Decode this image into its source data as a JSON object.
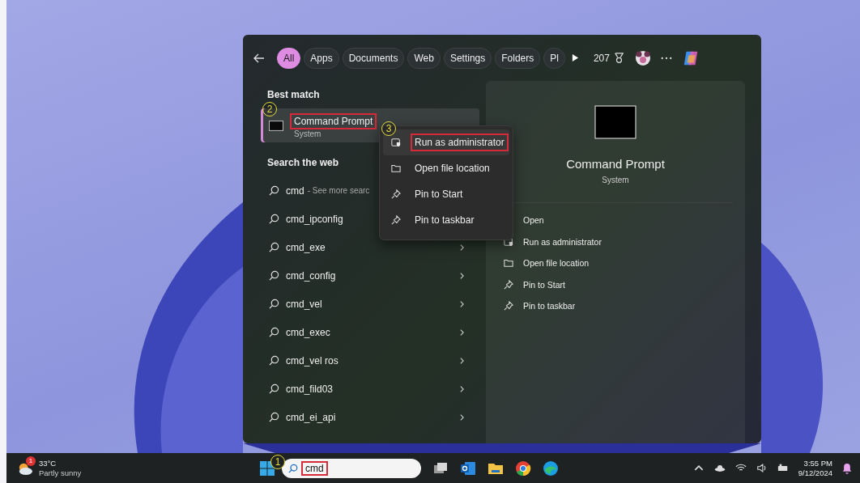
{
  "search_panel": {
    "filters": [
      {
        "label": "All",
        "selected": true
      },
      {
        "label": "Apps",
        "selected": false
      },
      {
        "label": "Documents",
        "selected": false
      },
      {
        "label": "Web",
        "selected": false
      },
      {
        "label": "Settings",
        "selected": false
      },
      {
        "label": "Folders",
        "selected": false
      },
      {
        "label": "Pl",
        "selected": false
      }
    ],
    "points": "207",
    "best_match": {
      "heading": "Best match",
      "title": "Command Prompt",
      "subtitle": "System",
      "selected": true,
      "highlighted": true,
      "callout": "2"
    },
    "web": {
      "heading": "Search the web",
      "results": [
        {
          "query": "cmd",
          "hint": "- See more searc"
        },
        {
          "query": "cmd_ipconfig"
        },
        {
          "query": "cmd_exe",
          "chevron": true
        },
        {
          "query": "cmd_config",
          "chevron": true
        },
        {
          "query": "cmd_vel",
          "chevron": true
        },
        {
          "query": "cmd_exec",
          "chevron": true
        },
        {
          "query": "cmd_vel ros",
          "chevron": true
        },
        {
          "query": "cmd_fild03",
          "chevron": true
        },
        {
          "query": "cmd_ei_api",
          "chevron": true
        }
      ]
    },
    "context_menu": {
      "callout": "3",
      "items": [
        {
          "label": "Run as administrator",
          "kind": "admin",
          "highlighted": true,
          "selected": true
        },
        {
          "label": "Open file location",
          "kind": "folder",
          "highlighted": false,
          "selected": false
        },
        {
          "label": "Pin to Start",
          "kind": "pin",
          "highlighted": false,
          "selected": false
        },
        {
          "label": "Pin to taskbar",
          "kind": "pin",
          "highlighted": false,
          "selected": false
        }
      ]
    },
    "detail": {
      "title": "Command Prompt",
      "subtitle": "System",
      "actions": [
        {
          "label": "Open",
          "kind": "open"
        },
        {
          "label": "Run as administrator",
          "kind": "admin"
        },
        {
          "label": "Open file location",
          "kind": "folder"
        },
        {
          "label": "Pin to Start",
          "kind": "pin"
        },
        {
          "label": "Pin to taskbar",
          "kind": "pin"
        }
      ]
    }
  },
  "taskbar": {
    "weather": {
      "badge": "1",
      "temperature": "33°C",
      "condition": "Partly sunny"
    },
    "search": {
      "value": "cmd",
      "callout": "1",
      "highlighted": true
    },
    "time": "3:55 PM",
    "date": "9/12/2024"
  }
}
